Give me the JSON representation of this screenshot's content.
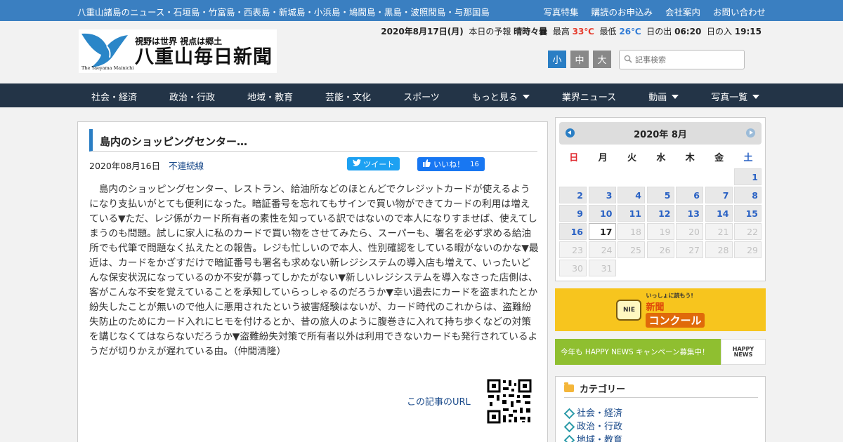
{
  "topbar": {
    "regions": "八重山諸島のニュース・石垣島・竹富島・西表島・新城島・小浜島・鳩間島・黒島・波照間島・与那国島",
    "links": [
      "写真特集",
      "購読のお申込み",
      "会社案内",
      "お問い合わせ"
    ]
  },
  "logo": {
    "tagline": "視野は世界 視点は郷土",
    "name": "八重山毎日新聞",
    "english": "The Yaeyama Mainichi"
  },
  "weather": {
    "date": "2020年8月17日(月)",
    "forecast_label": "本日の予報",
    "forecast": "晴時々曇",
    "high_label": "最高",
    "high": "33℃",
    "low_label": "最低",
    "low": "26℃",
    "sunrise_label": "日の出",
    "sunrise": "06:20",
    "sunset_label": "日の入",
    "sunset": "19:15"
  },
  "font_sizes": [
    "小",
    "中",
    "大"
  ],
  "search": {
    "placeholder": "記事検索"
  },
  "nav": {
    "items": [
      {
        "label": "社会・経済",
        "dropdown": false
      },
      {
        "label": "政治・行政",
        "dropdown": false
      },
      {
        "label": "地域・教育",
        "dropdown": false
      },
      {
        "label": "芸能・文化",
        "dropdown": false
      },
      {
        "label": "スポーツ",
        "dropdown": false
      },
      {
        "label": "もっと見る",
        "dropdown": true
      },
      {
        "label": "業界ニュース",
        "dropdown": false
      },
      {
        "label": "動画",
        "dropdown": true
      },
      {
        "label": "写真一覧",
        "dropdown": true
      }
    ]
  },
  "article": {
    "title": "島内のショッピングセンター…",
    "date": "2020年08月16日",
    "category": "不連続線",
    "tweet_label": "ツイート",
    "like_label": "いいね！",
    "like_count": "16",
    "body": "島内のショッピングセンター、レストラン、給油所などのほとんどでクレジットカードが使えるようになり支払いがとても便利になった。暗証番号を忘れてもサインで買い物ができてカードの利用は増えている▼ただ、レジ係がカード所有者の素性を知っている訳ではないので本人になりすませば、使えてしまうのも問題。試しに家人に私のカードで買い物をさせてみたら、スーパーも、署名を必ず求める給油所でも代筆で問題なく払えたとの報告。レジも忙しいので本人、性別確認をしている暇がないのかな▼最近は、カードをかざすだけで暗証番号も署名も求めない新レジシステムの導入店も増えて、いったいどんな保安状況になっているのか不安が募ってしかたがない▼新しいレジシステムを導入なさった店側は、客がこんな不安を覚えていることを承知していらっしゃるのだろうか▼幸い過去にカードを盗まれたとか紛失したことが無いので他人に悪用されたという被害経験はないが、カード時代のこれからは、盗難紛失防止のためにカード入れにヒモを付けるとか、昔の旅人のように腹巻きに入れて持ち歩くなどの対策を講じなくてはならないだろうか▼盗難紛失対策で所有者以外は利用できないカードも発行されているようだが切りかえが遅れている由。（仲間清隆）",
    "url_label": "この記事のURL"
  },
  "calendar": {
    "title": "2020年 8月",
    "weekdays": [
      "日",
      "月",
      "火",
      "水",
      "木",
      "金",
      "土"
    ],
    "leading_blanks": 6,
    "days_in_month": 31,
    "today": 17
  },
  "banners": {
    "contest": {
      "small": "いっしょに読もう!",
      "line1": "新聞",
      "line2": "コンクール",
      "badge": "NIE"
    },
    "happy": {
      "text": "今年も HAPPY NEWS キャンペーン募集中！",
      "logo_line1": "HAPPY",
      "logo_line2": "NEWS"
    }
  },
  "categories": {
    "title": "カテゴリー",
    "items": [
      "社会・経済",
      "政治・行政",
      "地域・教育"
    ]
  },
  "colors": {
    "topbar": "#3a7fc1",
    "nav": "#233447",
    "accent": "#2a7ec4",
    "high_temp": "#e53b2c",
    "low_temp": "#2f7bd6"
  }
}
